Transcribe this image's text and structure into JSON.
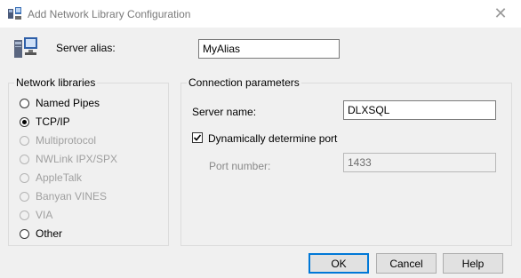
{
  "window": {
    "title": "Add Network Library Configuration",
    "close_glyph": "✕"
  },
  "alias": {
    "label": "Server alias:",
    "value": "MyAlias"
  },
  "network_libraries": {
    "title": "Network libraries",
    "items": [
      {
        "label": "Named Pipes",
        "checked": false,
        "enabled": true
      },
      {
        "label": "TCP/IP",
        "checked": true,
        "enabled": true
      },
      {
        "label": "Multiprotocol",
        "checked": false,
        "enabled": false
      },
      {
        "label": "NWLink IPX/SPX",
        "checked": false,
        "enabled": false
      },
      {
        "label": "AppleTalk",
        "checked": false,
        "enabled": false
      },
      {
        "label": "Banyan VINES",
        "checked": false,
        "enabled": false
      },
      {
        "label": "VIA",
        "checked": false,
        "enabled": false
      },
      {
        "label": "Other",
        "checked": false,
        "enabled": true
      }
    ]
  },
  "connection": {
    "title": "Connection parameters",
    "server_name_label": "Server name:",
    "server_name_value": "DLXSQL",
    "dynamic_port_label": "Dynamically determine port",
    "dynamic_port_checked": true,
    "port_label": "Port number:",
    "port_value": "1433"
  },
  "buttons": {
    "ok": "OK",
    "cancel": "Cancel",
    "help": "Help"
  },
  "colors": {
    "accent": "#0078d7",
    "window_bg": "#f0f0f0",
    "disabled_text": "#a0a0a0"
  },
  "icons": {
    "app": "network-config-icon",
    "server": "server-computer-icon",
    "check": "checkmark-icon"
  }
}
